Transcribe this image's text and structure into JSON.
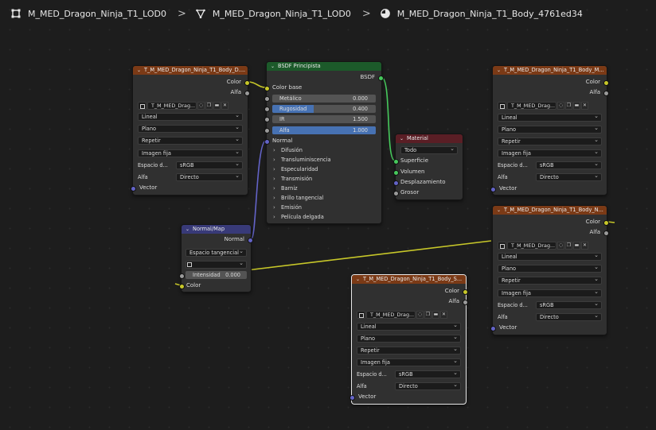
{
  "breadcrumb": {
    "item1": "M_MED_Dragon_Ninja_T1_LOD0",
    "item2": "M_MED_Dragon_Ninja_T1_LOD0",
    "item3": "M_MED_Dragon_Ninja_T1_Body_4761ed34",
    "sep": ">"
  },
  "tex1": {
    "title": "T_M_MED_Dragon_Ninja_T1_Body_D....",
    "out_color": "Color",
    "out_alpha": "Alfa",
    "image_name": "T_M_MED_Drag...",
    "interp": "Lineal",
    "proj": "Plano",
    "ext": "Repetir",
    "source": "Imagen fija",
    "cs_label": "Espacio d...",
    "cs_value": "sRGB",
    "alpha_label": "Alfa",
    "alpha_value": "Directo",
    "in_vector": "Vector"
  },
  "tex2": {
    "title": "T_M_MED_Dragon_Ninja_T1_Body_M...",
    "out_color": "Color",
    "out_alpha": "Alfa",
    "image_name": "T_M_MED_Drag...",
    "interp": "Lineal",
    "proj": "Plano",
    "ext": "Repetir",
    "source": "Imagen fija",
    "cs_label": "Espacio d...",
    "cs_value": "sRGB",
    "alpha_label": "Alfa",
    "alpha_value": "Directo",
    "in_vector": "Vector"
  },
  "tex3": {
    "title": "T_M_MED_Dragon_Ninja_T1_Body_N...",
    "out_color": "Color",
    "out_alpha": "Alfa",
    "image_name": "T_M_MED_Drag...",
    "interp": "Lineal",
    "proj": "Plano",
    "ext": "Repetir",
    "source": "Imagen fija",
    "cs_label": "Espacio d...",
    "cs_value": "sRGB",
    "alpha_label": "Alfa",
    "alpha_value": "Directo",
    "in_vector": "Vector"
  },
  "tex4": {
    "title": "T_M_MED_Dragon_Ninja_T1_Body_S...",
    "out_color": "Color",
    "out_alpha": "Alfa",
    "image_name": "T_M_MED_Drag...",
    "interp": "Lineal",
    "proj": "Plano",
    "ext": "Repetir",
    "source": "Imagen fija",
    "cs_label": "Espacio d...",
    "cs_value": "sRGB",
    "alpha_label": "Alfa",
    "alpha_value": "Directo",
    "in_vector": "Vector"
  },
  "bsdf": {
    "title": "BSDF Principista",
    "out_bsdf": "BSDF",
    "base_color": "Color base",
    "metallic_label": "Metálico",
    "metallic_value": "0.000",
    "metallic": 0.0,
    "roughness_label": "Rugosidad",
    "roughness_value": "0.400",
    "roughness": 0.4,
    "ior_label": "IR",
    "ior_value": "1.500",
    "alpha_label": "Alfa",
    "alpha_value": "1.000",
    "alpha": 1.0,
    "normal": "Normal",
    "panels": [
      "Difusión",
      "Transluminiscencia",
      "Especularidad",
      "Transmisión",
      "Barniz",
      "Brillo tangencial",
      "Emisión",
      "Película delgada"
    ]
  },
  "material": {
    "title": "Material",
    "target": "Todo",
    "surface": "Superficie",
    "volume": "Volumen",
    "displacement": "Desplazamiento",
    "thickness": "Grosor"
  },
  "normal_map": {
    "title": "Normal/Map",
    "out_normal": "Normal",
    "space": "Espacio tangencial",
    "uv_value": "",
    "strength_label": "Intensidad",
    "strength_value": "0.000",
    "in_color": "Color"
  },
  "colors": {
    "texture_header": "#7b3a16",
    "shader_header": "#1c5a2a",
    "output_header": "#5a1e25",
    "vector_header": "#383a78",
    "socket_color": "#c7c729",
    "socket_vector": "#6363c7",
    "socket_shader": "#46c95c",
    "accent": "#4772b3"
  }
}
